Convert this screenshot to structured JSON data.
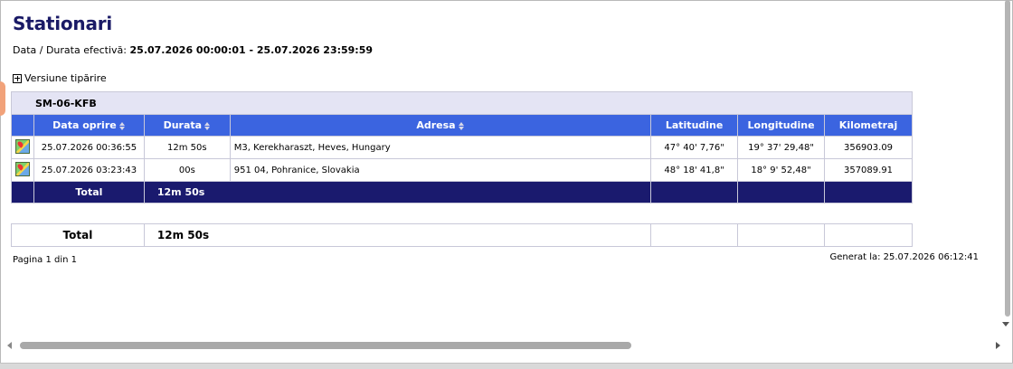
{
  "page": {
    "title": "Stationari",
    "period_label": "Data / Durata efectivă:",
    "period_value": "25.07.2026 00:00:01 - 25.07.2026 23:59:59",
    "print_version": "Versiune tipărire"
  },
  "table": {
    "group": "SM-06-KFB",
    "columns": {
      "stop_date": "Data oprire",
      "duration": "Durata",
      "address": "Adresa",
      "latitude": "Latitudine",
      "longitude": "Longitudine",
      "odometer": "Kilometraj"
    },
    "rows": [
      {
        "stop_date": "25.07.2026 00:36:55",
        "duration": "12m 50s",
        "address": "M3,   Kerekharaszt, Heves, Hungary",
        "latitude": "47° 40' 7,76\"",
        "longitude": "19° 37' 29,48\"",
        "odometer": "356903.09"
      },
      {
        "stop_date": "25.07.2026 03:23:43",
        "duration": "00s",
        "address": "951 04, Pohranice,  Slovakia",
        "latitude": "48° 18' 41,8\"",
        "longitude": "18° 9' 52,48\"",
        "odometer": "357089.91"
      }
    ],
    "total_label": "Total",
    "total_duration": "12m 50s"
  },
  "grand_total": {
    "label": "Total",
    "duration": "12m 50s"
  },
  "footer": {
    "pagination": "Pagina 1 din 1",
    "generated": "Generat la: 25.07.2026 06:12:41"
  },
  "colors": {
    "header_blue": "#3b64e0",
    "total_navy": "#1a1a6e",
    "group_bg": "#e4e4f4",
    "title": "#1a1a66"
  }
}
